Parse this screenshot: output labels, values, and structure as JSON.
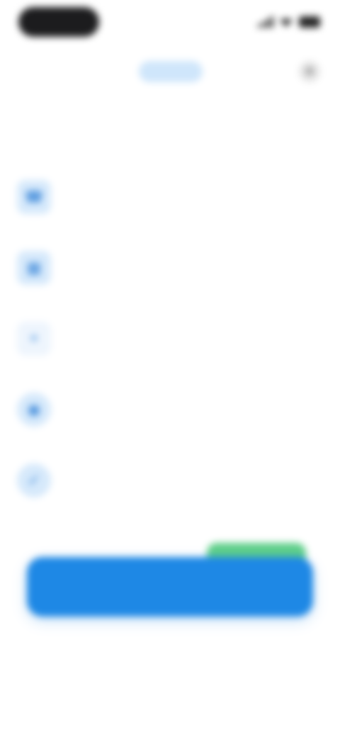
{
  "status_bar": {
    "time": "",
    "colors": {
      "pill": "#1c1c1e",
      "icons": "#222222"
    }
  },
  "header": {
    "logo_label": "",
    "close_icon": "close-icon",
    "title": ""
  },
  "features": [
    {
      "icon": "phone-icon",
      "title": "",
      "subtitle": ""
    },
    {
      "icon": "calendar-icon",
      "title": "",
      "subtitle": ""
    },
    {
      "icon": "sparkle-icon",
      "title": "",
      "subtitle": ""
    },
    {
      "icon": "globe-icon",
      "title": "",
      "subtitle": ""
    },
    {
      "icon": "check-circle-icon",
      "title": "",
      "subtitle": ""
    }
  ],
  "bottom": {
    "note": "",
    "badge": "",
    "cta_label": "",
    "cta_price": "",
    "footer_left": "",
    "footer_right": "",
    "restore": ""
  },
  "colors": {
    "accent": "#1e88e5",
    "accent_light": "#d6e9fb",
    "badge": "#5fcf8a",
    "text_dark": "#222222",
    "text_muted": "#9aa7b5"
  }
}
